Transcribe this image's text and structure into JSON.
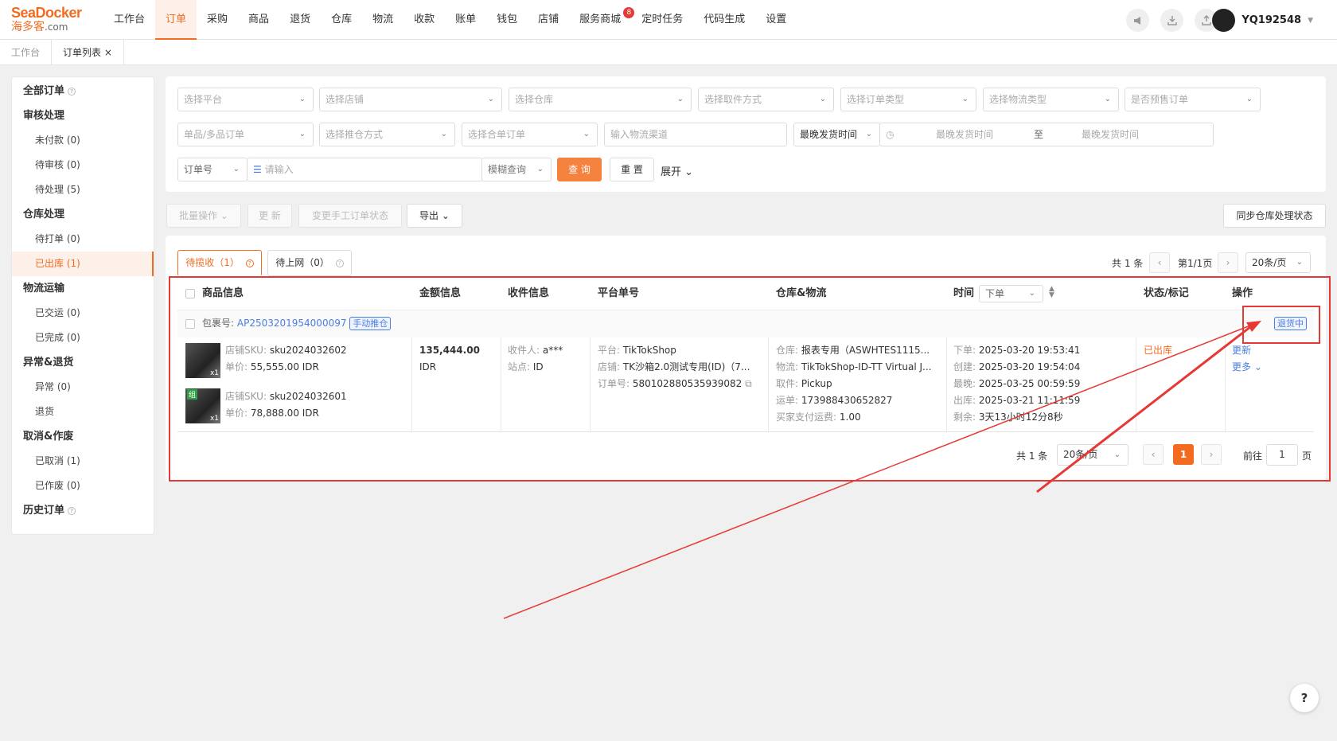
{
  "brand": {
    "name": "SeaDocker",
    "sub": "海多客",
    "suffix": ".com"
  },
  "nav": [
    "工作台",
    "订单",
    "采购",
    "商品",
    "退货",
    "仓库",
    "物流",
    "收款",
    "账单",
    "钱包",
    "店铺",
    "服务商城",
    "定时任务",
    "代码生成",
    "设置"
  ],
  "nav_badge": "8",
  "user": {
    "name": "YQ192548"
  },
  "page_tabs": [
    "工作台",
    "订单列表 ×"
  ],
  "sidebar": {
    "all_orders": "全部订单",
    "g1": "审核处理",
    "g1_items": [
      "未付款 (0)",
      "待审核 (0)",
      "待处理 (5)"
    ],
    "g2": "仓库处理",
    "g2_items": [
      "待打单 (0)",
      "已出库 (1)"
    ],
    "g3": "物流运输",
    "g3_items": [
      "已交运 (0)",
      "已完成 (0)"
    ],
    "g4": "异常&退货",
    "g4_items": [
      "异常 (0)",
      "退货"
    ],
    "g5": "取消&作废",
    "g5_items": [
      "已取消 (1)",
      "已作废 (0)"
    ],
    "history": "历史订单"
  },
  "filters": {
    "platform": "选择平台",
    "shop": "选择店铺",
    "warehouse": "选择仓库",
    "pickup": "选择取件方式",
    "order_type": "选择订单类型",
    "logistics_type": "选择物流类型",
    "presale": "是否预售订单",
    "sku_type": "单品/多品订单",
    "push_mode": "选择推仓方式",
    "merge": "选择合单订单",
    "channel_placeholder": "输入物流渠道",
    "time_field": "最晚发货时间",
    "time_start": "最晚发货时间",
    "time_to": "至",
    "time_end": "最晚发货时间",
    "order_field": "订单号",
    "input_placeholder": "请输入",
    "match": "模糊查询",
    "query": "查 询",
    "reset": "重 置",
    "expand": "展开"
  },
  "actions": {
    "batch": "批量操作",
    "refresh": "更 新",
    "change_status": "变更手工订单状态",
    "export": "导出",
    "sync": "同步仓库处理状态"
  },
  "status_tabs": [
    {
      "label": "待揽收（1）"
    },
    {
      "label": "待上网（0）"
    }
  ],
  "pager_top": {
    "total": "共 1 条",
    "page": "第1/1页",
    "size": "20条/页"
  },
  "columns": {
    "product": "商品信息",
    "amount": "金额信息",
    "receiver": "收件信息",
    "platform_no": "平台单号",
    "wh_logistics": "仓库&物流",
    "time": "时间",
    "time_sel": "下单",
    "status": "状态/标记",
    "ops": "操作"
  },
  "row": {
    "package_label": "包裹号:",
    "package_no": "AP2503201954000097",
    "tag": "手动推仓",
    "return_tag": "退货中",
    "sku_label": "店铺SKU:",
    "price_label": "单价:",
    "items": [
      {
        "sku": "sku2024032602",
        "price": "55,555.00 IDR",
        "qty": "x1"
      },
      {
        "sku": "sku2024032601",
        "price": "78,888.00 IDR",
        "qty": "x1",
        "mark": "组"
      }
    ],
    "amount": "135,444.00",
    "currency": "IDR",
    "receiver_label": "收件人:",
    "receiver": "a***",
    "site_label": "站点:",
    "site": "ID",
    "platform_label": "平台:",
    "platform": "TikTokShop",
    "shop_label": "店铺:",
    "shop": "TK沙箱2.0测试专用(ID)（7...",
    "order_label": "订单号:",
    "order_no": "580102880535939082",
    "wh_label": "仓库:",
    "wh": "报表专用（ASWHTES1115...",
    "lg_label": "物流:",
    "lg": "TikTokShop-ID-TT Virtual J...",
    "pick_label": "取件:",
    "pick": "Pickup",
    "waybill_label": "运单:",
    "waybill": "173988430652827",
    "fee_label": "买家支付运费:",
    "fee": "1.00",
    "t1_label": "下单:",
    "t1": "2025-03-20 19:53:41",
    "t2_label": "创建:",
    "t2": "2025-03-20 19:54:04",
    "t3_label": "最晚:",
    "t3": "2025-03-25 00:59:59",
    "t4_label": "出库:",
    "t4": "2025-03-21 11:11:59",
    "t5_label": "剩余:",
    "t5": "3天13小时12分8秒",
    "status": "已出库",
    "op1": "更新",
    "op2": "更多"
  },
  "pager_bottom": {
    "total": "共 1 条",
    "size": "20条/页",
    "current": "1",
    "goto": "前往",
    "goto_val": "1",
    "page_unit": "页"
  },
  "help": "?",
  "colors": {
    "accent": "#f26b21",
    "primary_btn": "#f6823f",
    "annotation": "#e53935",
    "link": "#4a7de0"
  }
}
